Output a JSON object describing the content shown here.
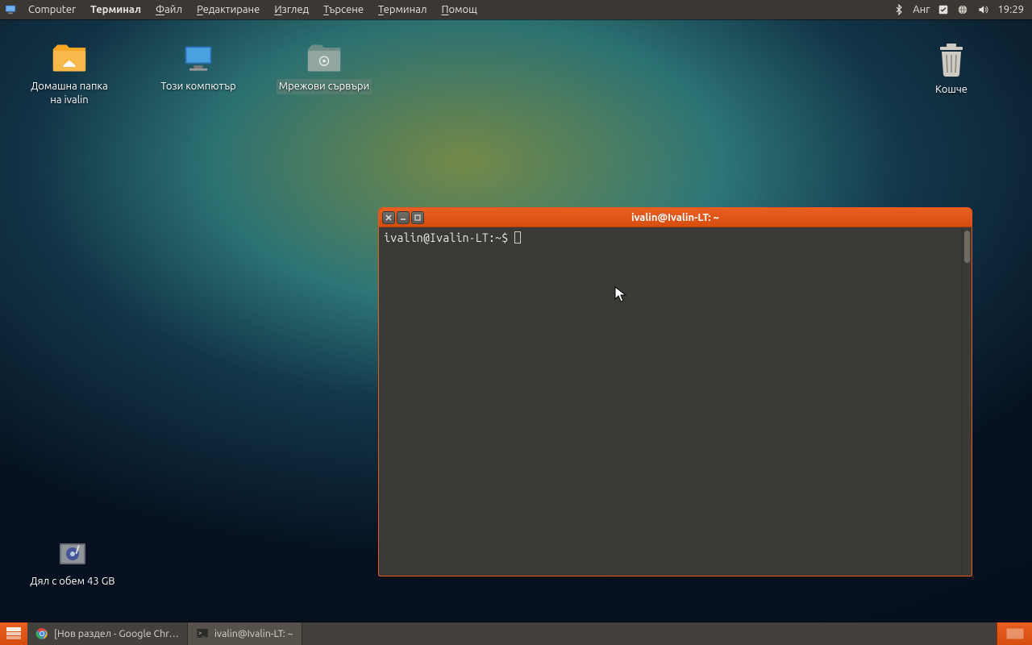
{
  "menubar": {
    "app_label": "Computer",
    "active_app": "Терминал",
    "items": [
      {
        "u": "Ф",
        "rest": "айл"
      },
      {
        "u": "Р",
        "rest": "едактиране"
      },
      {
        "u": "И",
        "rest": "зглед"
      },
      {
        "u": "Т",
        "rest": "ърсене"
      },
      {
        "u": "Т",
        "rest": "ерминал"
      },
      {
        "u": "П",
        "rest": "омощ"
      }
    ],
    "keyboard_layout": "Анг",
    "clock": "19:29"
  },
  "desktop": {
    "home": "Домашна папка\nна ivalin",
    "computer": "Този компютър",
    "network": "Мрежови сървъри",
    "trash": "Кошче",
    "volume": "Дял с обем 43 GB"
  },
  "terminal": {
    "title": "ivalin@Ivalin-LT: ~",
    "prompt": "ivalin@Ivalin-LT:~$ "
  },
  "taskbar": {
    "task1": "[Нов раздел - Google Chr…",
    "task2": "ivalin@Ivalin-LT: ~"
  }
}
